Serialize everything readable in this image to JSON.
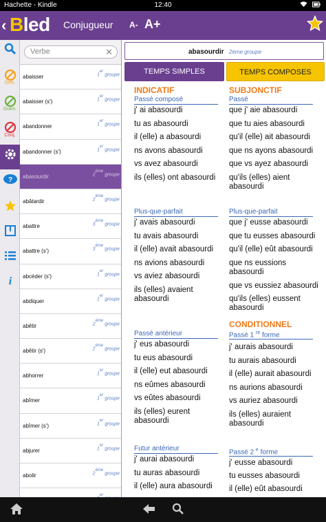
{
  "status": {
    "left": "Hachette - Kindle",
    "time": "12:40"
  },
  "header": {
    "logo_b": "B",
    "logo_rest": "led",
    "title": "Conjugueur",
    "font_smaller": "A-",
    "font_larger": "A+"
  },
  "rail": {
    "items": [
      {
        "icon": "search-icon",
        "label": ""
      },
      {
        "icon": "pen-orth-icon",
        "label": "Orth."
      },
      {
        "icon": "pen-gram-icon",
        "label": "Gram."
      },
      {
        "icon": "pen-conj-icon",
        "label": "Conj."
      },
      {
        "icon": "gear-icon",
        "label": ""
      },
      {
        "icon": "help-bubble-icon",
        "label": ""
      },
      {
        "icon": "star-icon",
        "label": ""
      },
      {
        "icon": "book-icon",
        "label": ""
      },
      {
        "icon": "list-icon",
        "label": ""
      },
      {
        "icon": "info-icon",
        "label": ""
      }
    ]
  },
  "search": {
    "placeholder": "Verbe"
  },
  "verbs": [
    {
      "name": "abaisser",
      "group_num": "1",
      "group_sup": "er",
      "group_word": "groupe"
    },
    {
      "name": "abaisser (s')",
      "group_num": "1",
      "group_sup": "er",
      "group_word": "groupe"
    },
    {
      "name": "abandonner",
      "group_num": "1",
      "group_sup": "er",
      "group_word": "groupe"
    },
    {
      "name": "abandonner (s')",
      "group_num": "1",
      "group_sup": "er",
      "group_word": "groupe"
    },
    {
      "name": "abasourdir",
      "group_num": "2",
      "group_sup": "ème",
      "group_word": "groupe"
    },
    {
      "name": "abâtardir",
      "group_num": "2",
      "group_sup": "ème",
      "group_word": "groupe"
    },
    {
      "name": "abattre",
      "group_num": "3",
      "group_sup": "ème",
      "group_word": "groupe"
    },
    {
      "name": "abattre (s')",
      "group_num": "3",
      "group_sup": "ème",
      "group_word": "groupe"
    },
    {
      "name": "abcéder (s')",
      "group_num": "1",
      "group_sup": "er",
      "group_word": "groupe"
    },
    {
      "name": "abdiquer",
      "group_num": "1",
      "group_sup": "er",
      "group_word": "groupe"
    },
    {
      "name": "abêtir",
      "group_num": "2",
      "group_sup": "ème",
      "group_word": "groupe"
    },
    {
      "name": "abêtir (s')",
      "group_num": "2",
      "group_sup": "ème",
      "group_word": "groupe"
    },
    {
      "name": "abhorrer",
      "group_num": "1",
      "group_sup": "er",
      "group_word": "groupe"
    },
    {
      "name": "abîmer",
      "group_num": "1",
      "group_sup": "er",
      "group_word": "groupe"
    },
    {
      "name": "abîmer (s')",
      "group_num": "1",
      "group_sup": "er",
      "group_word": "groupe"
    },
    {
      "name": "abjurer",
      "group_num": "1",
      "group_sup": "er",
      "group_word": "groupe"
    },
    {
      "name": "abolir",
      "group_num": "2",
      "group_sup": "ème",
      "group_word": "groupe"
    },
    {
      "name": "",
      "group_num": "1",
      "group_sup": "er",
      "group_word": "groupe"
    }
  ],
  "selected": {
    "verb": "abasourdir",
    "group": "2ème groupe"
  },
  "tabs": {
    "simple": "TEMPS SIMPLES",
    "compose": "TEMPS COMPOSES"
  },
  "moods": {
    "indicatif": "INDICATIF",
    "subjonctif": "SUBJONCTIF",
    "conditionnel": "CONDITIONNEL"
  },
  "tenses": {
    "passe_compose": {
      "title": "Passé composé",
      "forms": [
        "j' ai abasourdi",
        "tu as abasourdi",
        "il (elle) a abasourdi",
        "ns avons abasourdi",
        "vs avez abasourdi",
        "ils (elles) ont abasourdi"
      ]
    },
    "subj_passe": {
      "title": "Passé",
      "forms": [
        "que j' aie abasourdi",
        "que tu aies abasourdi",
        "qu'il (elle) ait abasourdi",
        "que ns ayons abasourdi",
        "que vs ayez abasourdi",
        "qu'ils (elles) aient abasourdi"
      ]
    },
    "plus_que_parfait": {
      "title": "Plus-que-parfait",
      "forms": [
        "j' avais abasourdi",
        "tu avais abasourdi",
        "il (elle) avait abasourdi",
        "ns avions abasourdi",
        "vs aviez abasourdi",
        "ils (elles) avaient abasourdi"
      ]
    },
    "subj_plus_que_parfait": {
      "title": "Plus-que-parfait",
      "forms": [
        "que j' eusse abasourdi",
        "que tu eusses abasourdi",
        "qu'il (elle) eût abasourdi",
        "que ns eussions abasourdi",
        "que vs eussiez abasourdi",
        "qu'ils (elles) eussent abasourdi"
      ]
    },
    "passe_anterieur": {
      "title": "Passé antérieur",
      "forms": [
        "j' eus abasourdi",
        "tu eus abasourdi",
        "il (elle) eut abasourdi",
        "ns eûmes abasourdi",
        "vs eûtes abasourdi",
        "ils (elles) eurent abasourdi"
      ]
    },
    "cond_passe1": {
      "title_a": "Passé 1",
      "title_sup": "re",
      "title_b": "forme",
      "forms": [
        "j' aurais abasourdi",
        "tu aurais abasourdi",
        "il (elle) aurait abasourdi",
        "ns aurions abasourdi",
        "vs auriez abasourdi",
        "ils (elles) auraient abasourdi"
      ]
    },
    "futur_anterieur": {
      "title": "Futur antérieur",
      "forms": [
        "j' aurai abasourdi",
        "tu auras abasourdi",
        "il (elle) aura abasourdi"
      ]
    },
    "cond_passe2": {
      "title_a": "Passé 2",
      "title_sup": "e",
      "title_b": "forme",
      "forms": [
        "j' eusse abasourdi",
        "tu eusses abasourdi",
        "il (elle) eût abasourdi"
      ]
    }
  },
  "colors": {
    "purple": "#6a3f8f",
    "yellow": "#f6c400",
    "orange": "#f07a18",
    "blue": "#3a67b8"
  }
}
